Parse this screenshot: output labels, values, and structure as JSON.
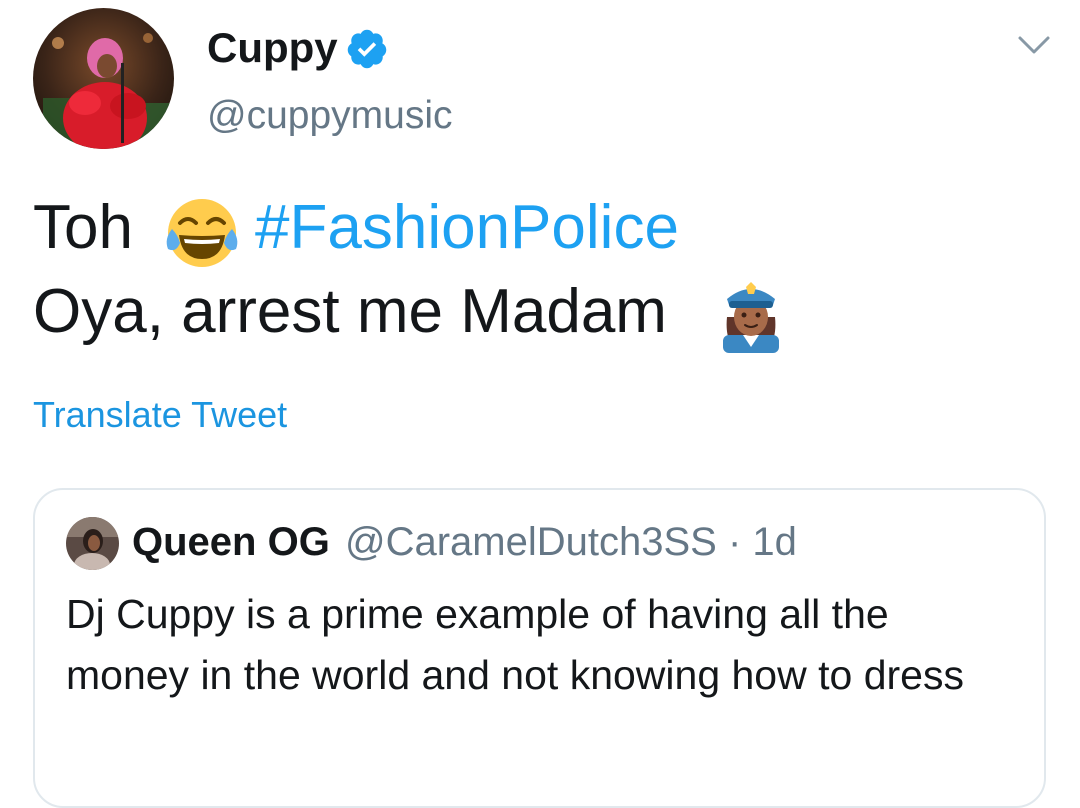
{
  "tweet": {
    "author": {
      "display_name": "Cuppy",
      "handle": "@cuppymusic",
      "verified": true,
      "avatar_icon": "profile-photo"
    },
    "menu_icon": "chevron-down-icon",
    "text": {
      "line1_word": "Toh",
      "line1_emoji": "face-with-tears-of-joy-emoji",
      "hashtag": "#FashionPolice",
      "line2_text": "Oya, arrest me Madam",
      "line2_emoji": "woman-police-officer-emoji"
    },
    "translate_label": "Translate Tweet",
    "quoted_tweet": {
      "display_name": "Queen OG",
      "handle_time": "@CaramelDutch3SS · 1d",
      "text": "Dj Cuppy is a prime example of having all the money in the world and not knowing how to dress"
    }
  },
  "colors": {
    "link_blue": "#1da1f2",
    "translate_blue": "#1b95e0",
    "secondary_gray": "#657786",
    "border": "#e1e8ed",
    "text": "#14171a"
  }
}
